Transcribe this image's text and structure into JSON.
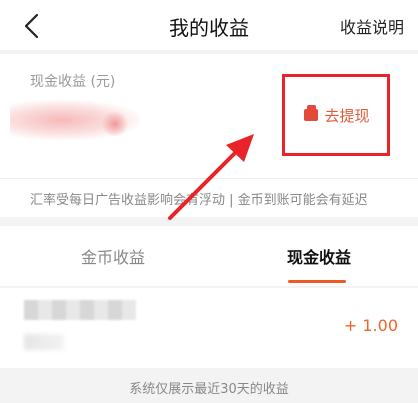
{
  "header": {
    "title": "我的收益",
    "explain_label": "收益说明"
  },
  "cash_card": {
    "label": "现金收益 (元)",
    "withdraw_label": "去提现",
    "notice": "汇率受每日广告收益影响会有浮动 | 金币到账可能会有延迟"
  },
  "tabs": [
    {
      "label": "金币收益",
      "active": false
    },
    {
      "label": "现金收益",
      "active": true
    }
  ],
  "record": {
    "amount": "+ 1.00"
  },
  "footer_text": "系统仅展示最近30天的收益",
  "colors": {
    "accent": "#f05a22",
    "highlight_box": "#e8242a"
  }
}
